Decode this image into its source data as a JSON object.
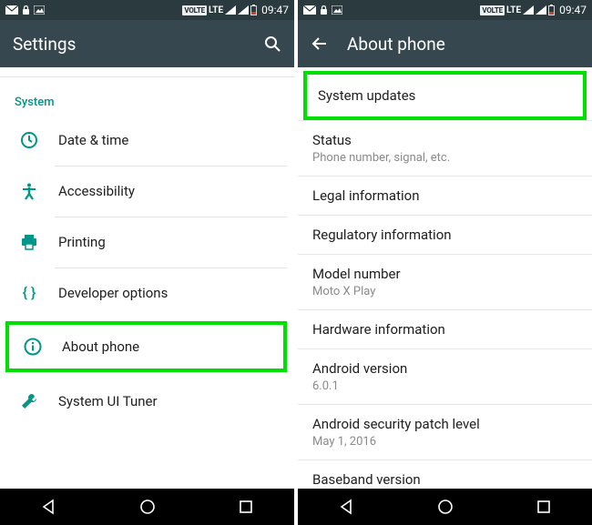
{
  "statusBar": {
    "volte": "VOLTE",
    "lte": "LTE",
    "clock": "09:47"
  },
  "left": {
    "title": "Settings",
    "sectionHeader": "System",
    "items": [
      {
        "label": "Date & time"
      },
      {
        "label": "Accessibility"
      },
      {
        "label": "Printing"
      },
      {
        "label": "Developer options"
      },
      {
        "label": "About phone"
      },
      {
        "label": "System UI Tuner"
      }
    ]
  },
  "right": {
    "title": "About phone",
    "items": [
      {
        "primary": "System updates"
      },
      {
        "primary": "Status",
        "secondary": "Phone number, signal, etc."
      },
      {
        "primary": "Legal information"
      },
      {
        "primary": "Regulatory information"
      },
      {
        "primary": "Model number",
        "secondary": "Moto X Play"
      },
      {
        "primary": "Hardware information"
      },
      {
        "primary": "Android version",
        "secondary": "6.0.1"
      },
      {
        "primary": "Android security patch level",
        "secondary": "May 1, 2016"
      },
      {
        "primary": "Baseband version"
      }
    ]
  }
}
